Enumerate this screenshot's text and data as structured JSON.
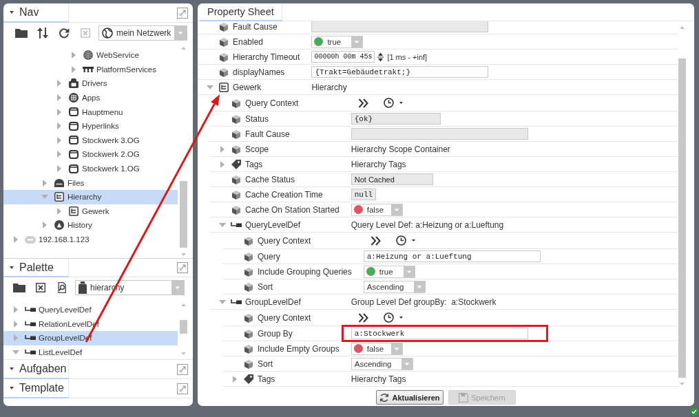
{
  "nav": {
    "title": "Nav",
    "tools": [
      {
        "kind": "folder",
        "disabled": false
      },
      {
        "kind": "sort",
        "disabled": false
      },
      {
        "kind": "refresh",
        "disabled": false
      },
      {
        "kind": "close",
        "disabled": true
      }
    ],
    "selector": "mein Netzwerk",
    "tree": [
      {
        "children": [
          {
            "children": [
              {
                "children": [
                  {
                    "children": [
                      {
                        "label": "WebService",
                        "kind": "web",
                        "expanded": false,
                        "selected": false
                      },
                      {
                        "label": "PlatformServices",
                        "kind": "platform",
                        "expanded": false,
                        "selected": false
                      }
                    ]
                  },
                  {
                    "label": "Drivers",
                    "kind": "driver",
                    "expanded": false,
                    "selected": false
                  },
                  {
                    "label": "Apps",
                    "kind": "apps",
                    "expanded": false,
                    "selected": false
                  },
                  {
                    "label": "Hauptmenu",
                    "kind": "folder",
                    "expanded": false,
                    "selected": false
                  },
                  {
                    "label": "Hyperlinks",
                    "kind": "folder",
                    "expanded": false,
                    "selected": false
                  },
                  {
                    "label": "Stockwerk 3.OG",
                    "kind": "folder",
                    "expanded": false,
                    "selected": false
                  },
                  {
                    "label": "Stockwerk 2.OG",
                    "kind": "folder",
                    "expanded": false,
                    "selected": false
                  },
                  {
                    "label": "Stockwerk 1.OG",
                    "kind": "folder",
                    "expanded": false,
                    "selected": false
                  }
                ]
              },
              {
                "label": "Files",
                "kind": "files",
                "expanded": false,
                "selected": false
              },
              {
                "label": "Hierarchy",
                "kind": "hierarchy",
                "expanded": true,
                "selected": true,
                "children": [
                  {
                    "label": "Gewerk",
                    "kind": "hierarchy",
                    "expanded": false,
                    "selected": false
                  }
                ]
              },
              {
                "label": "History",
                "kind": "history",
                "expanded": false,
                "selected": false
              }
            ]
          }
        ]
      },
      {
        "label": "192.168.1.123",
        "kind": "host",
        "expanded": false,
        "selected": false
      }
    ]
  },
  "palette": {
    "title": "Palette",
    "tools": [
      {
        "kind": "folder",
        "disabled": false
      },
      {
        "kind": "close",
        "disabled": false
      },
      {
        "kind": "find",
        "disabled": false
      }
    ],
    "selector": "hierarchy",
    "items": [
      {
        "label": "QueryLevelDef",
        "expanded": false,
        "selected": false
      },
      {
        "label": "RelationLevelDef",
        "expanded": false,
        "selected": false
      },
      {
        "label": "GroupLevelDef",
        "expanded": false,
        "selected": true
      },
      {
        "label": "ListLevelDef",
        "expanded": true,
        "selected": false
      }
    ]
  },
  "side_panels": [
    {
      "title": "Aufgaben"
    },
    {
      "title": "Template"
    }
  ],
  "property_sheet": {
    "title": "Property Sheet",
    "rows": [
      {
        "label": "Fault Cause",
        "kind": "property",
        "value": {
          "kind": "readonly"
        }
      },
      {
        "label": "Enabled",
        "kind": "property",
        "value": {
          "kind": "dropdown",
          "text": "true",
          "color": "#4caa58"
        }
      },
      {
        "label": "Hierarchy Timeout",
        "kind": "property",
        "value": {
          "kind": "timespan",
          "text": "00000h 00m 45s",
          "range": "[1 ms - +inf]"
        }
      },
      {
        "label": "displayNames",
        "kind": "property",
        "value": {
          "kind": "input",
          "text": "{Trakt=Gebäudetrakt;}"
        }
      },
      {
        "label": "Gewerk",
        "kind": "hierarchy",
        "expanded": true,
        "value": {
          "kind": "text",
          "text": "Hierarchy"
        },
        "children": [
          {
            "label": "Query Context",
            "kind": "property",
            "value": {
              "kind": "query_context"
            }
          },
          {
            "label": "Status",
            "kind": "property",
            "value": {
              "kind": "status",
              "text": "{ok}"
            }
          },
          {
            "label": "Fault Cause",
            "kind": "property",
            "value": {
              "kind": "readonly"
            }
          },
          {
            "label": "Scope",
            "kind": "property",
            "expanded": false,
            "value": {
              "kind": "text",
              "text": "Hierarchy Scope Container"
            }
          },
          {
            "label": "Tags",
            "kind": "tags",
            "expanded": false,
            "value": {
              "kind": "text",
              "text": "Hierarchy Tags"
            }
          },
          {
            "label": "Cache Status",
            "kind": "property",
            "value": {
              "kind": "status_label",
              "text": "Not Cached"
            }
          },
          {
            "label": "Cache Creation Time",
            "kind": "property",
            "value": {
              "kind": "compact",
              "text": "null"
            }
          },
          {
            "label": "Cache On Station Started",
            "kind": "property",
            "value": {
              "kind": "dropdown",
              "text": "false",
              "color": "#e05562"
            }
          },
          {
            "label": "QueryLevelDef",
            "kind": "level_def",
            "expanded": true,
            "value": {
              "kind": "text",
              "text": "Query Level Def: a:Heizung or a:Lueftung"
            },
            "children": [
              {
                "label": "Query Context",
                "kind": "property",
                "value": {
                  "kind": "query_context"
                }
              },
              {
                "label": "Query",
                "kind": "property",
                "value": {
                  "kind": "input",
                  "text": "a:Heizung or a:Lueftung"
                }
              },
              {
                "label": "Include Grouping Queries",
                "kind": "property",
                "value": {
                  "kind": "dropdown",
                  "text": "true",
                  "color": "#4caa58"
                }
              },
              {
                "label": "Sort",
                "kind": "property",
                "value": {
                  "kind": "dropdown",
                  "text": "Ascending"
                }
              }
            ]
          },
          {
            "label": "GroupLevelDef",
            "kind": "level_def",
            "expanded": true,
            "value": {
              "kind": "text",
              "text": "Group Level Def groupBy:  a:Stockwerk"
            },
            "children": [
              {
                "label": "Query Context",
                "kind": "property",
                "value": {
                  "kind": "query_context"
                }
              },
              {
                "label": "Group By",
                "kind": "property",
                "highlighted": true,
                "value": {
                  "kind": "input",
                  "text": "a:Stockwerk"
                }
              },
              {
                "label": "Include Empty Groups",
                "kind": "property",
                "value": {
                  "kind": "dropdown",
                  "text": "false",
                  "color": "#e05562"
                }
              },
              {
                "label": "Sort",
                "kind": "property",
                "value": {
                  "kind": "dropdown",
                  "text": "Ascending"
                }
              },
              {
                "label": "Tags",
                "kind": "tags",
                "expanded": false,
                "value": {
                  "kind": "text",
                  "text": "Hierarchy Tags"
                }
              }
            ]
          }
        ]
      }
    ],
    "buttons": [
      {
        "label": "Aktualisieren",
        "kind": "refresh",
        "disabled": false
      },
      {
        "label": "Speichern",
        "kind": "save",
        "disabled": true
      }
    ]
  }
}
